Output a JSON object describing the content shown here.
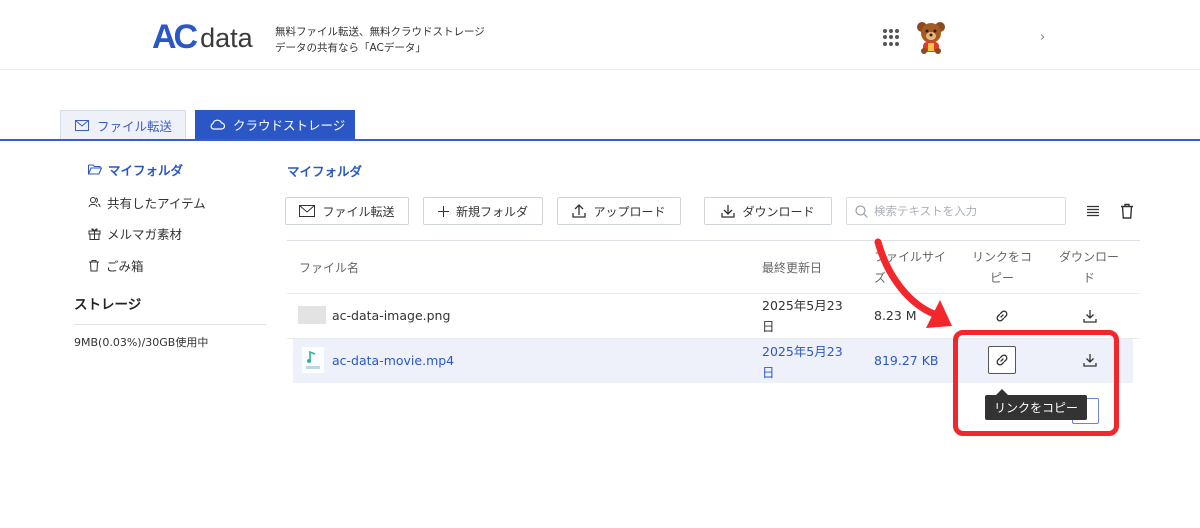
{
  "header": {
    "logo_ac": "AC",
    "logo_data": "data",
    "tagline_line1": "無料ファイル転送、無料クラウドストレージ",
    "tagline_line2": "データの共有なら「ACデータ」",
    "chevron": "›"
  },
  "tabs": [
    {
      "label": "ファイル転送",
      "icon": "mail-icon",
      "active": false
    },
    {
      "label": "クラウドストレージ",
      "icon": "cloud-icon",
      "active": true
    }
  ],
  "sidebar": {
    "items": [
      {
        "label": "マイフォルダ",
        "icon": "folder-open-icon",
        "active": true
      },
      {
        "label": "共有したアイテム",
        "icon": "shared-users-icon",
        "active": false
      },
      {
        "label": "メルマガ素材",
        "icon": "gift-icon",
        "active": false
      },
      {
        "label": "ごみ箱",
        "icon": "trash-icon",
        "active": false
      }
    ],
    "storage_title": "ストレージ",
    "storage_usage": "9MB(0.03%)/30GB使用中"
  },
  "main": {
    "title": "マイフォルダ",
    "toolbar": {
      "transfer_label": "ファイル転送",
      "new_folder_label": "新規フォルダ",
      "upload_label": "アップロード",
      "download_label": "ダウンロード",
      "search_placeholder": "検索テキストを入力"
    },
    "table": {
      "headers": {
        "name": "ファイル名",
        "modified": "最終更新日",
        "size_line1": "ファイルサイ",
        "size_line2": "ズ",
        "copy_link_line1": "リンクをコ",
        "copy_link_line2": "ピー",
        "download_line1": "ダウンロー",
        "download_line2": "ド"
      },
      "rows": [
        {
          "name": "ac-data-image.png",
          "date_line1": "2025年5月23",
          "date_line2": "日",
          "size": "8.23 M",
          "selected": false
        },
        {
          "name": "ac-data-movie.mp4",
          "date_line1": "2025年5月23",
          "date_line2": "日",
          "size": "819.27 KB",
          "selected": true
        }
      ]
    },
    "tooltip": "リンクをコピー",
    "pagination_next": "›"
  },
  "colors": {
    "brand_blue": "#2b57c6",
    "annotation_red": "#f2262b",
    "selected_row_bg": "#eef1fa"
  }
}
